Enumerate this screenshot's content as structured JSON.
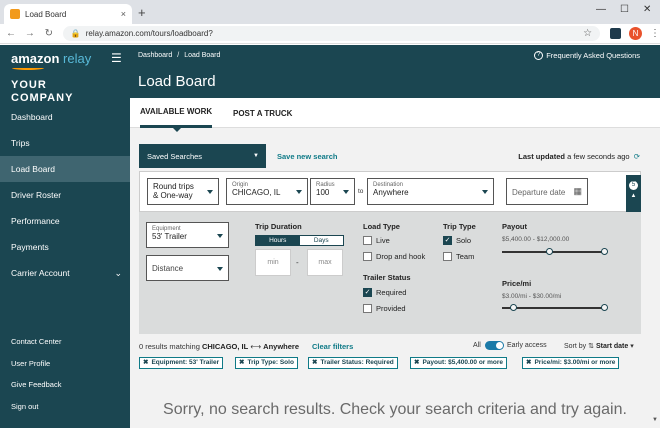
{
  "browser": {
    "tab_title": "Load Board",
    "tab_close": "×",
    "new_tab": "+",
    "minimize": "—",
    "maximize": "☐",
    "close": "✕",
    "url": "relay.amazon.com/tours/loadboard?",
    "avatar": "N"
  },
  "sidebar": {
    "brand_a": "amazon",
    "brand_b": " relay",
    "company_line1": "YOUR",
    "company_line2": "COMPANY",
    "items": [
      {
        "label": "Dashboard"
      },
      {
        "label": "Trips"
      },
      {
        "label": "Load Board"
      },
      {
        "label": "Driver Roster"
      },
      {
        "label": "Performance"
      },
      {
        "label": "Payments"
      },
      {
        "label": "Carrier Account"
      }
    ],
    "footer": [
      {
        "label": "Contact Center"
      },
      {
        "label": "User Profile"
      },
      {
        "label": "Give Feedback"
      },
      {
        "label": "Sign out"
      }
    ]
  },
  "header": {
    "crumb_1": "Dashboard",
    "crumb_sep": "/",
    "crumb_2": "Load Board",
    "faq": "Frequently Asked Questions",
    "title": "Load Board"
  },
  "tabs": {
    "available": "AVAILABLE WORK",
    "post": "POST A TRUCK"
  },
  "toolbar": {
    "saved_searches": "Saved Searches",
    "save_new": "Save new search",
    "updated_label": "Last updated",
    "updated_value": "a few seconds ago"
  },
  "search": {
    "trip_type_line1": "Round trips",
    "trip_type_line2": "& One-way",
    "origin_label": "Origin",
    "origin_value": "CHICAGO, IL",
    "radius_label": "Radius",
    "radius_value": "100",
    "to": "to",
    "destination_label": "Destination",
    "destination_value": "Anywhere",
    "departure_placeholder": "Departure date",
    "filter_count": "5"
  },
  "filters": {
    "equipment_label": "Equipment",
    "equipment_value": "53' Trailer",
    "distance": "Distance",
    "trip_duration": "Trip Duration",
    "hours": "Hours",
    "days": "Days",
    "min": "min",
    "max": "max",
    "dash": "-",
    "load_type": "Load Type",
    "live": "Live",
    "drop_and_hook": "Drop and hook",
    "trip_type": "Trip Type",
    "solo": "Solo",
    "team": "Team",
    "trailer_status": "Trailer Status",
    "required": "Required",
    "provided": "Provided",
    "payout": "Payout",
    "payout_range": "$5,400.00 - $12,000.00",
    "price_mi": "Price/mi",
    "price_range": "$3.00/mi - $30.00/mi"
  },
  "results": {
    "count_text": "0 results matching",
    "origin": "CHICAGO, IL",
    "arrow": "⟷",
    "dest": "Anywhere",
    "clear": "Clear filters",
    "all": "All",
    "early": "Early access",
    "sort_by": "Sort by",
    "sort_value": "Start date"
  },
  "chips": [
    "Equipment: 53' Trailer",
    "Trip Type: Solo",
    "Trailer Status: Required",
    "Payout: $5,400.00 or more",
    "Price/mi: $3.00/mi or more"
  ],
  "empty_message": "Sorry, no search results. Check your search criteria and try again."
}
